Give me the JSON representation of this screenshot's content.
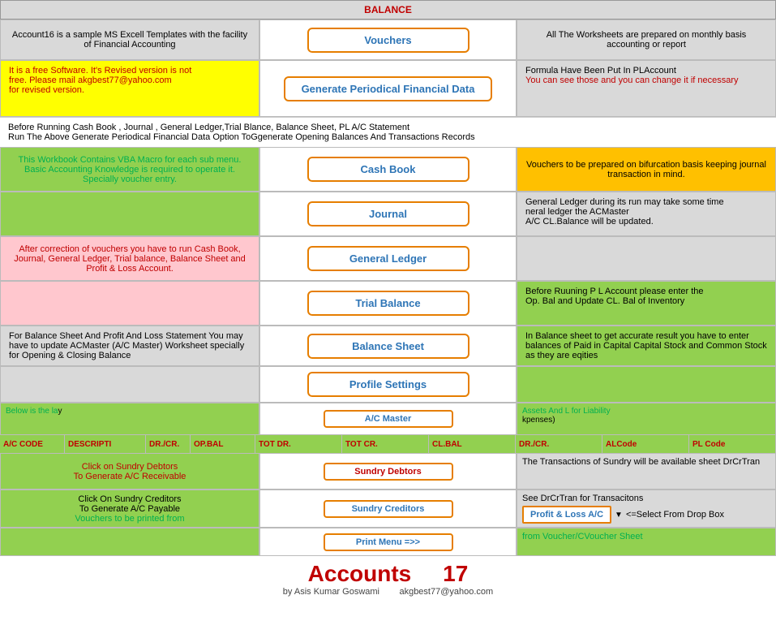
{
  "header": {
    "balance_label": "BALANCE"
  },
  "vouchers_row": {
    "left_text": "Account16 is a sample MS Excell Templates with the facility of Financial Accounting",
    "btn_label": "Vouchers",
    "right_text": "All The Worksheets are prepared on monthly basis accounting or report"
  },
  "generate_row": {
    "left_line1": "It is a free Software. It's Revised version is not",
    "left_line2": "free.  Please mail akgbest77@yahoo.com",
    "left_line3": "for revised version.",
    "btn_label": "Generate Periodical Financial Data",
    "right_line1": "Formula Have Been Put In PLAccount",
    "right_line2": "You can see those and you can change it if necessary"
  },
  "info_text": {
    "line1": "Before Running Cash Book , Journal , General Ledger,Trial Blance, Balance Sheet, PL A/C Statement",
    "line2": "Run The Above Generate Periodical Financial Data Option ToGgenerate Opening Balances And Transactions Records"
  },
  "cashbook_row": {
    "left_text": "This Workbook Contains VBA Macro for each sub menu. Basic Accounting Knowledge is required to operate it. Specially voucher entry.",
    "btn_label": "Cash Book",
    "right_text": "Vouchers to be prepared on bifurcation basis keeping journal transaction in mind."
  },
  "journal_row": {
    "left_text": "",
    "btn_label": "Journal",
    "right_line1": "General Ledger during its run may take some time",
    "right_line2": "neral ledger the ACMaster",
    "right_line3": "A/C CL.Balance will be updated."
  },
  "gl_row": {
    "left_text": "After correction of vouchers you have to run Cash Book, Journal, General Ledger, Trial balance, Balance Sheet and Profit & Loss Account.",
    "btn_label": "General Ledger",
    "right_text": ""
  },
  "tb_row": {
    "left_text": "",
    "btn_label": "Trial Balance",
    "right_line1": "Before Ruuning P L Account please enter the",
    "right_line2": "Op. Bal and Update CL. Bal of Inventory"
  },
  "bs_row": {
    "left_text": "For Balance Sheet And Profit And Loss Statement You may have to update ACMaster (A/C Master) Worksheet specially for Opening & Closing Balance",
    "btn_label": "Balance Sheet",
    "right_text": "In Balance sheet to get accurate result you have to enter balances of Paid in Capital Capital Stock and Common Stock as they are eqities"
  },
  "profile_row": {
    "left_text": "",
    "btn_label": "Profile Settings",
    "right_text": ""
  },
  "acmaster_header": {
    "left_text_green": "Below is the la",
    "left_text_cont": "y",
    "right_text_green": "Assets And L for Liability",
    "right_text_cont": "kpenses)",
    "btn_label": "A/C Master"
  },
  "col_headers": {
    "ac_code": "A/C CODE",
    "description": "DESCRIPTI",
    "dr_cr": "DR./CR.",
    "op_bal": "OP.BAL",
    "tot_dr": "TOT DR.",
    "tot_cr": "TOT CR.",
    "cl_bal": "CL.BAL",
    "dr_cr2": "DR./CR.",
    "alcode": "ALCode",
    "pl_code": "PL Code"
  },
  "sundry_debtors_row": {
    "left_line1": "Click on Sundry Debtors",
    "left_line2": "To Generate A/C Receivable",
    "btn_label": "Sundry Debtors",
    "right_text": "The Transactions of Sundry will be available sheet DrCrTran"
  },
  "sundry_creditors_row": {
    "left_line1": "Click On Sundry Creditors",
    "left_line2": "To Generate A/C Payable",
    "left_line3": "Vouchers to be printed from",
    "btn_label": "Sundry Creditors",
    "right_text": "See DrCrTran for Transacitons"
  },
  "print_menu_row": {
    "left_text": "",
    "btn_label": "Print Menu =>>",
    "right_pl_label": "Profit & Loss A/C",
    "right_dropdown": "<=Select From Drop Box",
    "right_text2": "from Voucher/CVoucher Sheet"
  },
  "footer": {
    "title": "Accounts",
    "number": "17",
    "author": "by Asis Kumar Goswami",
    "email": "akgbest77@yahoo.com"
  }
}
